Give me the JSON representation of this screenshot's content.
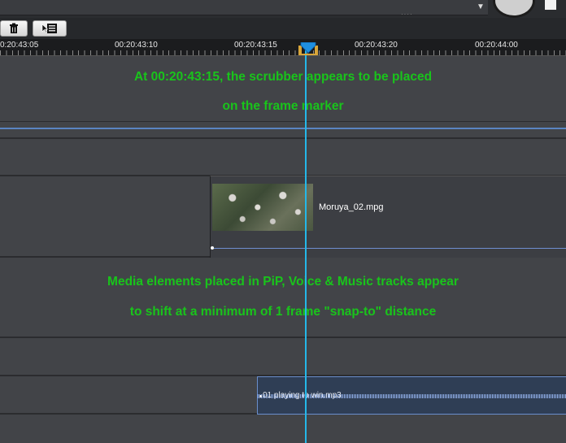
{
  "ruler": {
    "labels": [
      "0:20:43:05",
      "00:20:43:10",
      "00:20:43:15",
      "00:20:43:20",
      "00:20:44:00"
    ]
  },
  "tracks": {
    "video_clip": {
      "name": "Moruya_02.mpg"
    },
    "audio_clip": {
      "name": "01 playing to win.mp3"
    }
  },
  "annotations": {
    "line1": "At 00:20:43:15, the scrubber appears to be placed",
    "line2": "on the frame marker",
    "line3": "Media elements placed in PiP, Voice & Music tracks appear",
    "line4": "to shift at a minimum of 1 frame \"snap-to\" distance"
  },
  "colors": {
    "annotation": "#19c41b",
    "scrubber": "#24b8e9",
    "audio_clip_border": "#6a8ecc"
  },
  "icons": {
    "toolbar": [
      "trash-icon",
      "list-cursor-icon"
    ],
    "scrubber": "playhead-icon"
  }
}
